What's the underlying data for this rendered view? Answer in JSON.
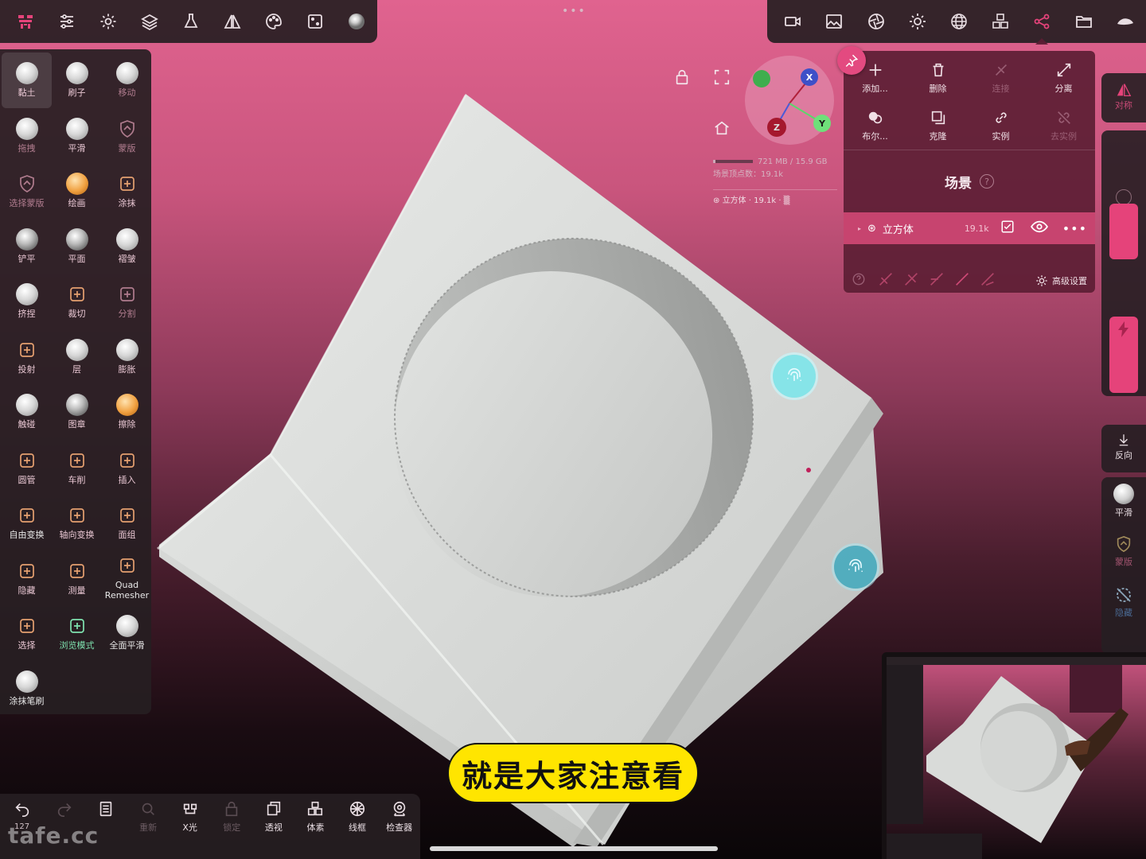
{
  "colors": {
    "accent": "#e5437a",
    "scene_panel": "#5c1e34",
    "subtitle_bg": "#ffe500",
    "axis_x": "#b0203a",
    "axis_y": "#5ad86a",
    "axis_z": "#4a5ad8"
  },
  "top_left_toolbar": {
    "icons": [
      "logo-icon",
      "sliders-icon",
      "gear-icon",
      "layers-icon",
      "flask-icon",
      "symmetry-icon",
      "palette-icon",
      "dice-icon",
      "material-ball-icon"
    ]
  },
  "top_right_toolbar": {
    "icons": [
      "video-icon",
      "image-icon",
      "aperture-icon",
      "sun-icon",
      "sphere-grid-icon",
      "cubes-icon",
      "scene-graph-icon",
      "folder-icon",
      "model-icon"
    ]
  },
  "tools": [
    {
      "label": "黏土",
      "icon": "clay-brush-icon",
      "style": "ball",
      "active": true
    },
    {
      "label": "刷子",
      "icon": "standard-brush-icon",
      "style": "ball"
    },
    {
      "label": "移动",
      "icon": "move-brush-icon",
      "style": "ball",
      "dim": true
    },
    {
      "label": "拖拽",
      "icon": "drag-brush-icon",
      "style": "ball",
      "dim": true
    },
    {
      "label": "平滑",
      "icon": "smooth-brush-icon",
      "style": "ball"
    },
    {
      "label": "蒙版",
      "icon": "mask-shield-icon",
      "style": "shield",
      "dim": true
    },
    {
      "label": "选择蒙版",
      "icon": "select-mask-icon",
      "style": "shield",
      "dim": true
    },
    {
      "label": "绘画",
      "icon": "paint-brush-icon",
      "style": "orange"
    },
    {
      "label": "涂抹",
      "icon": "smudge-icon",
      "style": "glyph"
    },
    {
      "label": "铲平",
      "icon": "flatten-brush-icon",
      "style": "dark"
    },
    {
      "label": "平面",
      "icon": "plane-brush-icon",
      "style": "dark"
    },
    {
      "label": "褶皱",
      "icon": "crease-brush-icon",
      "style": "ball"
    },
    {
      "label": "挤捏",
      "icon": "pinch-brush-icon",
      "style": "ball"
    },
    {
      "label": "裁切",
      "icon": "trim-icon",
      "style": "glyph"
    },
    {
      "label": "分割",
      "icon": "split-icon",
      "style": "glyph",
      "dim": true
    },
    {
      "label": "投射",
      "icon": "project-icon",
      "style": "glyph"
    },
    {
      "label": "层",
      "icon": "layer-brush-icon",
      "style": "ball"
    },
    {
      "label": "膨胀",
      "icon": "inflate-brush-icon",
      "style": "ball"
    },
    {
      "label": "触碰",
      "icon": "tube-brush-icon",
      "style": "ball"
    },
    {
      "label": "图章",
      "icon": "stamp-icon",
      "style": "dark"
    },
    {
      "label": "擦除",
      "icon": "erase-icon",
      "style": "orange"
    },
    {
      "label": "圆管",
      "icon": "tube-curve-icon",
      "style": "glyph"
    },
    {
      "label": "车削",
      "icon": "lathe-icon",
      "style": "glyph"
    },
    {
      "label": "插入",
      "icon": "insert-icon",
      "style": "glyph"
    },
    {
      "label": "自由变换",
      "icon": "free-transform-icon",
      "style": "glyph",
      "white": true
    },
    {
      "label": "轴向变换",
      "icon": "gizmo-transform-icon",
      "style": "glyph"
    },
    {
      "label": "面组",
      "icon": "face-group-icon",
      "style": "glyph"
    },
    {
      "label": "隐藏",
      "icon": "hide-icon",
      "style": "glyph"
    },
    {
      "label": "测量",
      "icon": "ruler-icon",
      "style": "glyph"
    },
    {
      "label": "Quad Remesher",
      "icon": "quad-remesher-icon",
      "style": "glyph",
      "white": true
    },
    {
      "label": "选择",
      "icon": "select-icon",
      "style": "glyph"
    },
    {
      "label": "浏览模式",
      "icon": "camera-icon",
      "style": "glyph",
      "green": true
    },
    {
      "label": "全面平滑",
      "icon": "global-smooth-icon",
      "style": "ball",
      "white": true
    },
    {
      "label": "涂抹笔刷",
      "icon": "smudge-brush-icon",
      "style": "ball",
      "white": true
    }
  ],
  "viewport": {
    "gizmo": {
      "x_label": "X",
      "y_label": "Y",
      "z_label": "Z"
    },
    "stats": {
      "memory": "721 MB / 15.9 GB",
      "memory_fraction": 0.05,
      "vertices": "场景顶点数：19.1k",
      "object": "立方体 · 19.1k · ▒"
    }
  },
  "scene": {
    "actions": [
      {
        "label": "添加...",
        "icon": "plus-icon"
      },
      {
        "label": "删除",
        "icon": "trash-icon"
      },
      {
        "label": "连接",
        "icon": "join-icon",
        "dim": true
      },
      {
        "label": "分离",
        "icon": "separate-icon"
      },
      {
        "label": "布尔...",
        "icon": "boolean-icon"
      },
      {
        "label": "克隆",
        "icon": "clone-icon"
      },
      {
        "label": "实例",
        "icon": "link-icon"
      },
      {
        "label": "去实例",
        "icon": "unlink-icon",
        "dim": true
      }
    ],
    "title": "场景",
    "help": "?",
    "item": {
      "name": "立方体",
      "count": "19.1k"
    },
    "advanced": "高级设置"
  },
  "right_bar": {
    "symmetry": "对称",
    "reverse": "反向",
    "smooth": "平滑",
    "mask": "蒙版",
    "hide": "隐藏"
  },
  "bottom_toolbar": {
    "undo_count": "127",
    "buttons": [
      {
        "label": "",
        "icon": "undo-icon"
      },
      {
        "label": "",
        "icon": "redo-icon",
        "dim": true
      },
      {
        "label": "",
        "icon": "list-icon"
      },
      {
        "label": "重新",
        "icon": "search-icon",
        "dim": true
      },
      {
        "label": "X光",
        "icon": "xray-icon"
      },
      {
        "label": "锁定",
        "icon": "lock-icon",
        "dim": true
      },
      {
        "label": "透视",
        "icon": "perspective-icon"
      },
      {
        "label": "体素",
        "icon": "voxel-icon"
      },
      {
        "label": "线框",
        "icon": "wireframe-icon"
      },
      {
        "label": "检查器",
        "icon": "inspector-icon"
      }
    ]
  },
  "watermark": "tafe.cc",
  "subtitle": "就是大家注意看"
}
